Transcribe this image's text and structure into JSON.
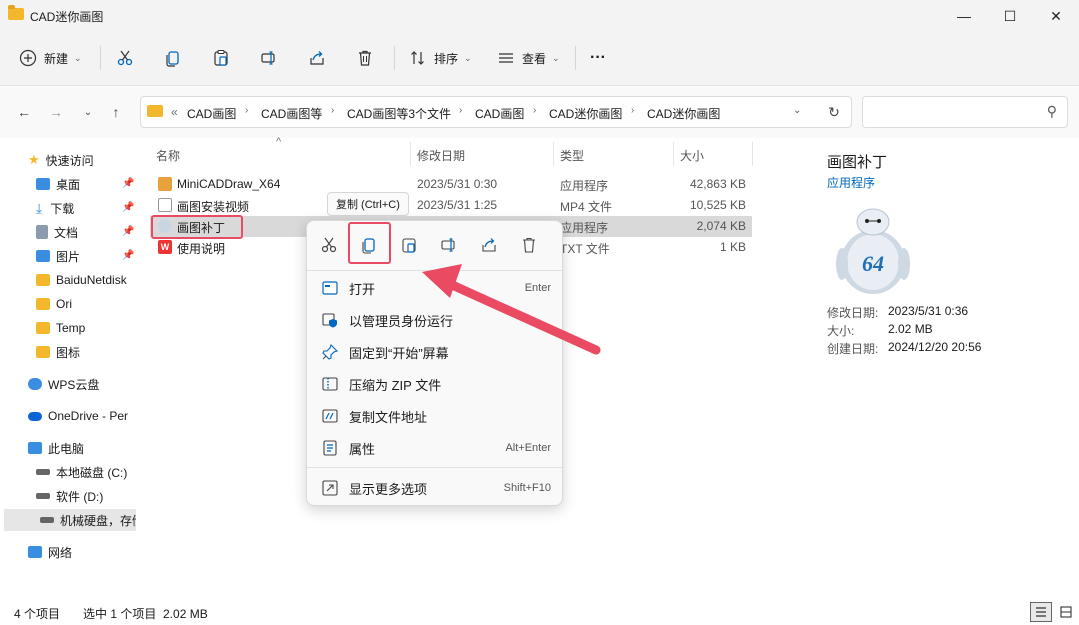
{
  "window": {
    "title": "CAD迷你画图",
    "minimize_glyph": "—",
    "maximize_glyph": "☐",
    "close_glyph": "✕"
  },
  "toolbar": {
    "new_label": "新建",
    "sort_label": "排序",
    "view_label": "查看",
    "more_label": "···",
    "caret": "⌄"
  },
  "nav": {
    "back": "←",
    "forward": "→",
    "recent": "⌄",
    "up": "↑"
  },
  "address": {
    "overflow": "«",
    "crumbs": [
      "CAD画图",
      "CAD画图等",
      "CAD画图等3个文件",
      "CAD画图",
      "CAD迷你画图",
      "CAD迷你画图"
    ],
    "separator": "›",
    "dropdown": "⌄",
    "refresh": "↻"
  },
  "search": {
    "icon": "⚲"
  },
  "sidebar": {
    "items": [
      {
        "label": "快速访问",
        "icon": "star-icon"
      },
      {
        "label": "桌面",
        "icon": "desktop-icon"
      },
      {
        "label": "下载",
        "icon": "download-icon"
      },
      {
        "label": "文档",
        "icon": "document-icon"
      },
      {
        "label": "图片",
        "icon": "picture-icon"
      },
      {
        "label": "BaiduNetdisk",
        "icon": "folder-icon"
      },
      {
        "label": "Ori",
        "icon": "folder-icon"
      },
      {
        "label": "Temp",
        "icon": "folder-icon"
      },
      {
        "label": "图标",
        "icon": "folder-icon"
      },
      {
        "label": "WPS云盘",
        "icon": "cloud-icon"
      },
      {
        "label": "OneDrive - Per",
        "icon": "onedrive-icon"
      },
      {
        "label": "此电脑",
        "icon": "pc-icon"
      },
      {
        "label": "本地磁盘 (C:)",
        "icon": "drive-icon"
      },
      {
        "label": "软件 (D:)",
        "icon": "drive-icon"
      },
      {
        "label": "机械硬盘，存储",
        "icon": "drive-icon"
      },
      {
        "label": "网络",
        "icon": "network-icon"
      }
    ],
    "pin_glyph": "📌"
  },
  "columns": {
    "name": "名称",
    "date": "修改日期",
    "type": "类型",
    "size": "大小",
    "sort_arrow": "^"
  },
  "files": [
    {
      "name": "MiniCADDraw_X64",
      "date": "2023/5/31 0:30",
      "type": "应用程序",
      "size": "42,863 KB",
      "icon": "app-icon"
    },
    {
      "name": "画图安装视频",
      "date": "2023/5/31 1:25",
      "type": "MP4 文件",
      "size": "10,525 KB",
      "icon": "video-file-icon"
    },
    {
      "name": "画图补丁",
      "date": "",
      "type": "应用程序",
      "size": "2,074 KB",
      "icon": "patch-app-icon"
    },
    {
      "name": "使用说明",
      "date": "",
      "type": "TXT 文件",
      "size": "1 KB",
      "icon": "wps-doc-icon"
    }
  ],
  "tooltip": "复制 (Ctrl+C)",
  "context_menu": {
    "items": [
      {
        "label": "打开",
        "shortcut": "Enter"
      },
      {
        "label": "以管理员身份运行",
        "shortcut": ""
      },
      {
        "label": "固定到“开始”屏幕",
        "shortcut": ""
      },
      {
        "label": "压缩为 ZIP 文件",
        "shortcut": ""
      },
      {
        "label": "复制文件地址",
        "shortcut": ""
      },
      {
        "label": "属性",
        "shortcut": "Alt+Enter"
      },
      {
        "label": "显示更多选项",
        "shortcut": "Shift+F10"
      }
    ]
  },
  "details": {
    "name": "画图补丁",
    "type": "应用程序",
    "badge": "64",
    "modified_label": "修改日期:",
    "modified_value": "2023/5/31 0:36",
    "size_label": "大小:",
    "size_value": "2.02 MB",
    "created_label": "创建日期:",
    "created_value": "2024/12/20 20:56"
  },
  "status": {
    "count": "4 个项目",
    "selection": "选中 1 个项目  2.02 MB"
  },
  "colors": {
    "highlight": "#ea4a62",
    "folder": "#f2b72d",
    "accent": "#0067c0"
  }
}
